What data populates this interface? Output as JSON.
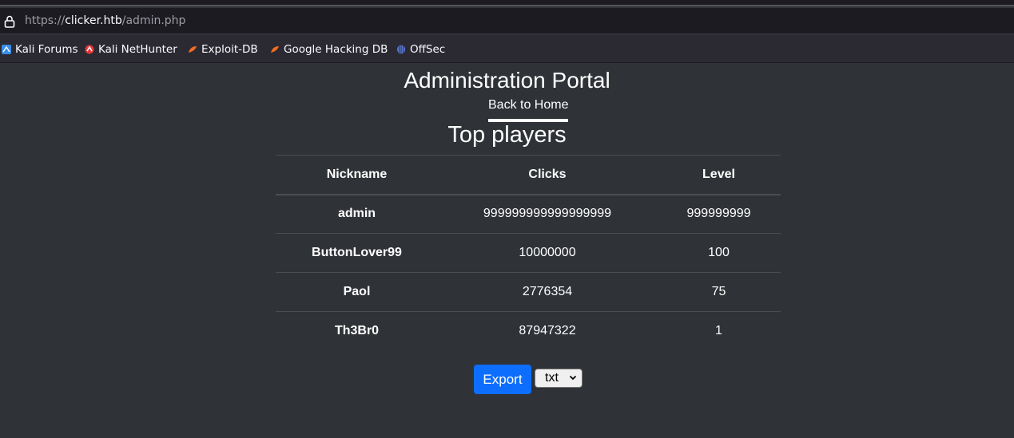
{
  "browser": {
    "url_scheme": "https://",
    "url_host": "clicker.htb",
    "url_path": "/admin.php",
    "bookmarks": [
      {
        "label": "Kali Forums",
        "icon": "kali-forums-icon"
      },
      {
        "label": "Kali NetHunter",
        "icon": "kali-nethunter-icon"
      },
      {
        "label": "Exploit-DB",
        "icon": "exploit-db-icon"
      },
      {
        "label": "Google Hacking DB",
        "icon": "google-hacking-db-icon"
      },
      {
        "label": "OffSec",
        "icon": "offsec-icon"
      }
    ]
  },
  "page": {
    "title": "Administration Portal",
    "back_link": "Back to Home",
    "section_title": "Top players"
  },
  "table": {
    "headers": [
      "Nickname",
      "Clicks",
      "Level"
    ],
    "rows": [
      {
        "nickname": "admin",
        "clicks": "999999999999999999",
        "level": "999999999"
      },
      {
        "nickname": "ButtonLover99",
        "clicks": "10000000",
        "level": "100"
      },
      {
        "nickname": "Paol",
        "clicks": "2776354",
        "level": "75"
      },
      {
        "nickname": "Th3Br0",
        "clicks": "87947322",
        "level": "1"
      }
    ]
  },
  "export": {
    "button_label": "Export",
    "format_selected": "txt"
  },
  "colors": {
    "background": "#2f3237",
    "export_button": "#0d6efd"
  }
}
